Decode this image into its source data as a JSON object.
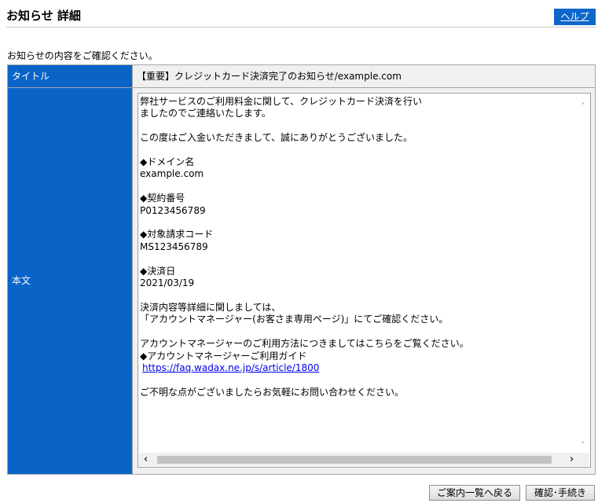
{
  "header": {
    "title": "お知らせ 詳細",
    "help_label": "ヘルプ"
  },
  "intro_text": "お知らせの内容をご確認ください。",
  "detail": {
    "title_label": "タイトル",
    "title_value": "【重要】クレジットカード決済完了のお知らせ/example.com",
    "body_label": "本文",
    "body_text_before_link": "弊社サービスのご利用料金に関して、クレジットカード決済を行い\nましたのでご連絡いたします。\n\nこの度はご入金いただきまして、誠にありがとうございました。\n\n◆ドメイン名\nexample.com\n\n◆契約番号\nP0123456789\n\n◆対象請求コード\nMS123456789\n\n◆決済日\n2021/03/19\n\n決済内容等詳細に関しましては、\n「アカウントマネージャー(お客さま専用ページ)」にてご確認ください。\n\nアカウントマネージャーのご利用方法につきましてはこちらをご覧ください。\n◆アカウントマネージャーご利用ガイド",
    "body_link": "https://faq.wadax.ne.jp/s/article/1800",
    "body_text_after_link": "\n\nご不明な点がございましたらお気軽にお問い合わせください。"
  },
  "buttons": {
    "back_label": "ご案内一覧へ戻る",
    "confirm_label": "確認･手続き"
  },
  "colors": {
    "accent": "#0a64c8",
    "cell_bg": "#f0f0f0"
  }
}
